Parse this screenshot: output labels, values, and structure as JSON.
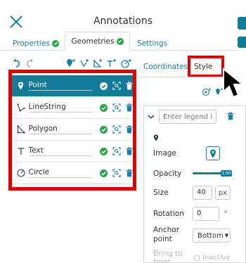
{
  "window": {
    "title": "Annotations"
  },
  "tabs": [
    {
      "label": "Properties",
      "active": false
    },
    {
      "label": "Geometries",
      "active": true
    },
    {
      "label": "Settings",
      "active": false
    }
  ],
  "subtabs": {
    "coordinates": "Coordinates",
    "style": "Style"
  },
  "geometries": [
    {
      "label": "Point",
      "icon": "map-marker-icon",
      "selected": true
    },
    {
      "label": "LineString",
      "icon": "linestring-icon",
      "selected": false
    },
    {
      "label": "Polygon",
      "icon": "polygon-icon",
      "selected": false
    },
    {
      "label": "Text",
      "icon": "text-icon",
      "selected": false
    },
    {
      "label": "Circle",
      "icon": "circle-icon",
      "selected": false
    }
  ],
  "style": {
    "legend_placeholder": "Enter legend la",
    "image_label": "Image",
    "opacity_label": "Opacity",
    "opacity_value": "1.00",
    "size_label": "Size",
    "size_value": "40",
    "size_unit": "px",
    "rotation_label": "Rotation",
    "rotation_value": "0",
    "rotation_unit": "°",
    "anchor_label_1": "Anchor",
    "anchor_label_2": "point",
    "anchor_value": "Bottom",
    "bring_label_1": "Bring to",
    "bring_label_2": "front",
    "inactive_label": "Inactive"
  },
  "colors": {
    "accent": "#127b97",
    "highlight": "#e20000",
    "check": "#2aa54a"
  }
}
